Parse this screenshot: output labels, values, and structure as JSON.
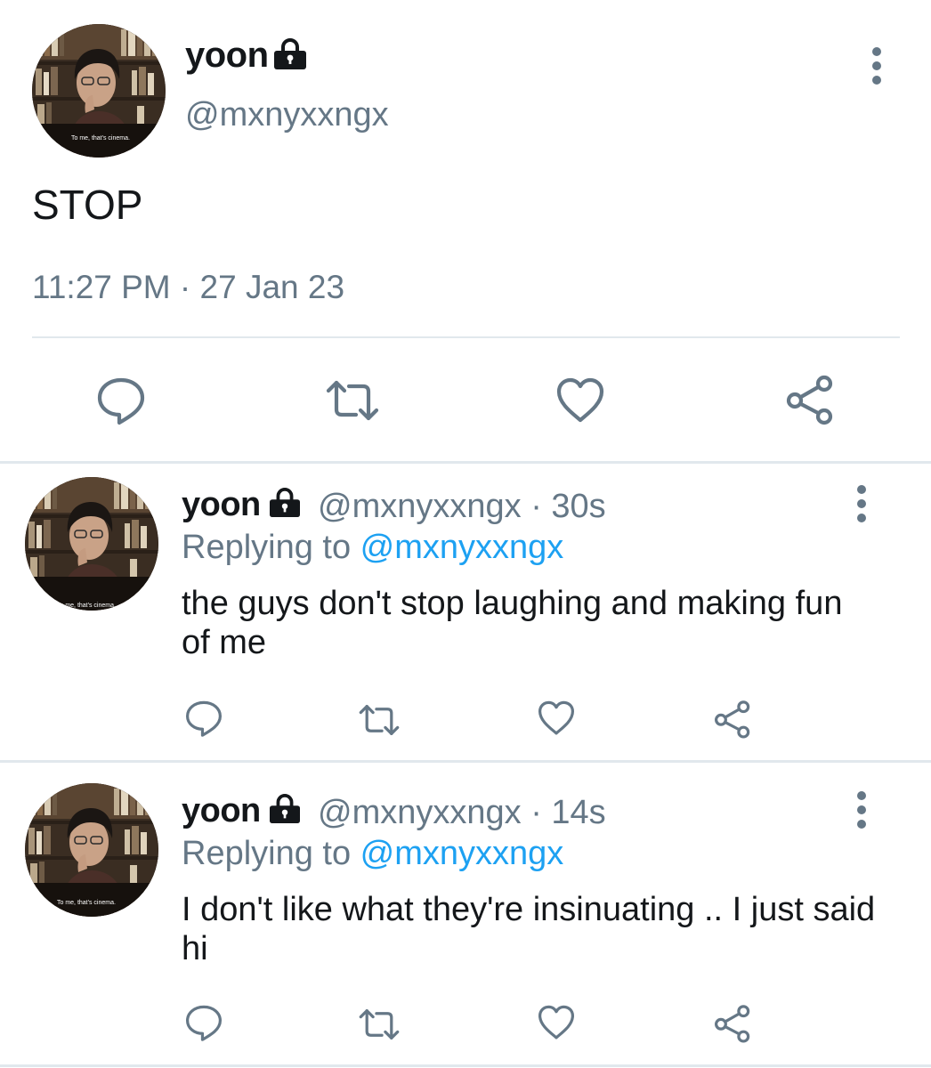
{
  "main_tweet": {
    "display_name": "yoon",
    "handle": "@mxnyxxngx",
    "text": "STOP",
    "timestamp": "11:27 PM · 27 Jan 23",
    "avatar_caption": "To me, that's cinema.",
    "icons": {
      "lock": "lock-icon",
      "more": "more-vertical-icon",
      "actions": [
        "reply-icon",
        "retweet-icon",
        "like-icon",
        "share-icon"
      ]
    }
  },
  "replies": [
    {
      "display_name": "yoon",
      "handle_time": "@mxnyxxngx · 30s",
      "replying_prefix": "Replying to ",
      "replying_to": "@mxnyxxngx",
      "text": "the guys don't stop laughing and making fun of me",
      "avatar_caption": "To me, that's cinema."
    },
    {
      "display_name": "yoon",
      "handle_time": "@mxnyxxngx · 14s",
      "replying_prefix": "Replying to ",
      "replying_to": "@mxnyxxngx",
      "text": "I don't like what they're insinuating .. I just said hi",
      "avatar_caption": "To me, that's cinema."
    }
  ],
  "colors": {
    "text": "#14171a",
    "secondary": "#657786",
    "link": "#1da1f2",
    "divider": "#e1e8ed",
    "icon": "#657786"
  }
}
